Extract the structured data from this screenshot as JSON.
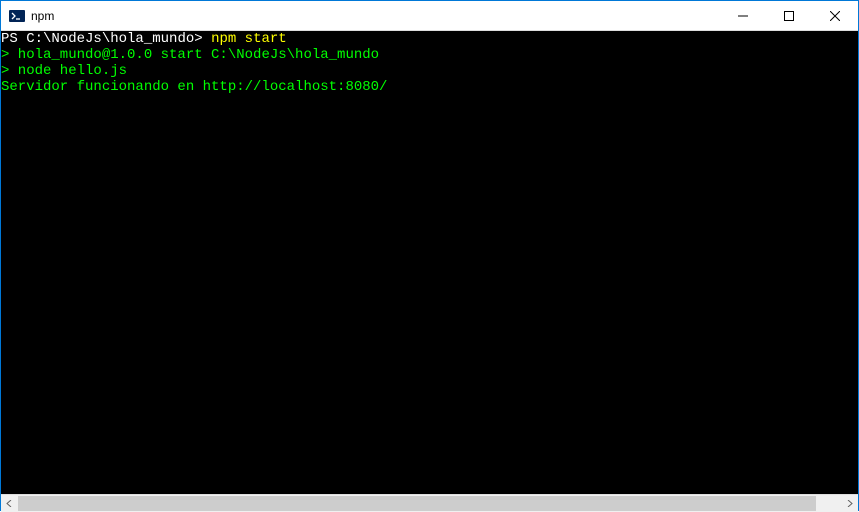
{
  "window": {
    "title": "npm"
  },
  "terminal": {
    "promptPrefix": "PS ",
    "promptPath": "C:\\NodeJs\\hola_mundo",
    "promptSuffix": "> ",
    "command": "npm start",
    "lines": [
      "",
      "> hola_mundo@1.0.0 start C:\\NodeJs\\hola_mundo",
      "> node hello.js",
      "",
      "Servidor funcionando en http://localhost:8080/"
    ]
  },
  "colors": {
    "terminalBg": "#000000",
    "terminalGreen": "#00ff00",
    "promptYellow": "#ffff00",
    "promptWhite": "#ffffff"
  }
}
